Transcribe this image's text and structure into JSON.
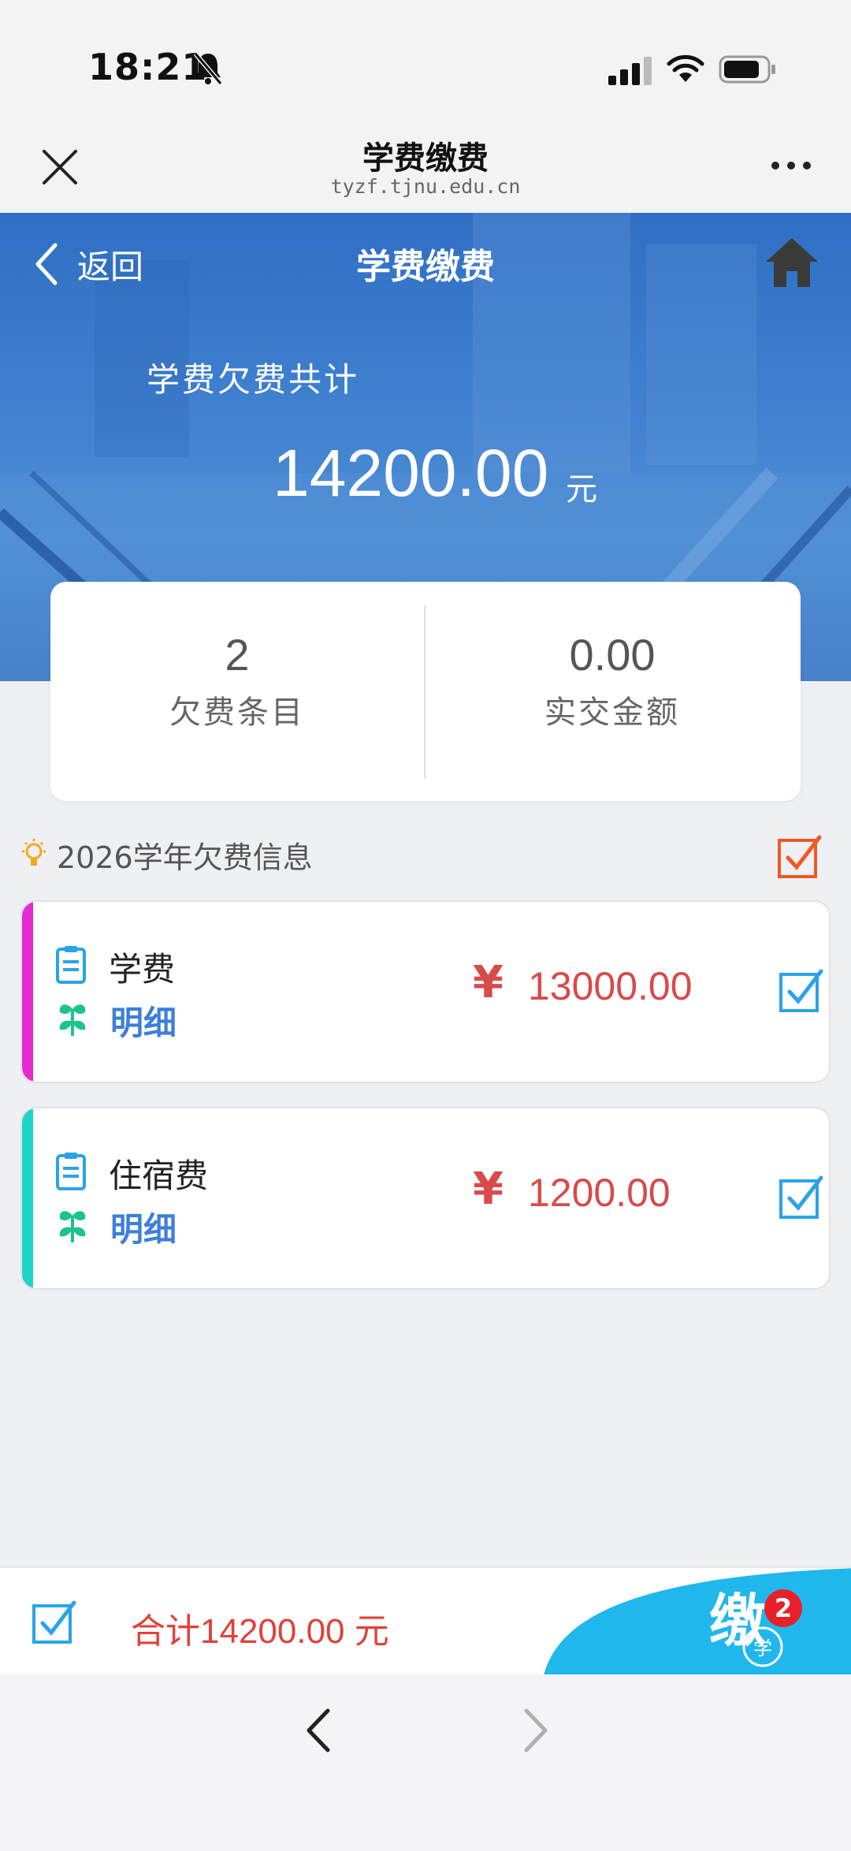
{
  "status_bar": {
    "time": "18:21"
  },
  "browser": {
    "title": "学费缴费",
    "url": "tyzf.tjnu.edu.cn"
  },
  "header": {
    "back_label": "返回",
    "title": "学费缴费"
  },
  "banner": {
    "owed_label": "学费欠费共计",
    "owed_amount": "14200.00",
    "unit": "元"
  },
  "summary": {
    "items_count": "2",
    "items_label": "欠费条目",
    "paid_amount": "0.00",
    "paid_label": "实交金额"
  },
  "section": {
    "title": "2026学年欠费信息"
  },
  "fees": [
    {
      "name": "学费",
      "detail_label": "明细",
      "currency": "¥",
      "amount": "13000.00",
      "accent": "#e62ad1",
      "checked": true
    },
    {
      "name": "住宿费",
      "detail_label": "明细",
      "currency": "¥",
      "amount": "1200.00",
      "accent": "#1dd4c8",
      "checked": true
    }
  ],
  "pay_bar": {
    "total_text": "合计14200.00 元",
    "badge_count": "2"
  },
  "colors": {
    "brand_blue": "#3d7fd9",
    "price_red": "#d94a4a",
    "check_blue": "#2aa3e8",
    "pay_cyan": "#20b8ec",
    "select_orange": "#ee5a24"
  },
  "icons": [
    "bell-slash-icon",
    "signal-icon",
    "wifi-icon",
    "battery-icon",
    "close-icon",
    "more-icon",
    "chevron-left-icon",
    "home-icon",
    "lightbulb-icon",
    "clipboard-icon",
    "leaf-icon",
    "checkbox-checked-icon"
  ]
}
